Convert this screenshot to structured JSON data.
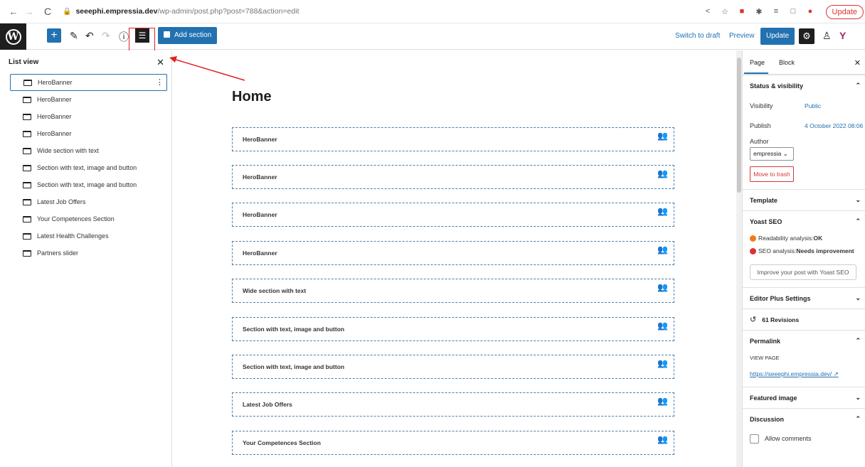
{
  "browser": {
    "back": "←",
    "forward": "→",
    "reload": "C",
    "url_host": "seeephi.empressia.dev",
    "url_path": "/wp-admin/post.php?post=788&action=edit",
    "update_label": "Update"
  },
  "toolbar": {
    "add_section_label": "Add section",
    "switch_to_draft_label": "Switch to draft",
    "preview_label": "Preview",
    "update_label": "Update"
  },
  "list_view": {
    "title": "List view",
    "items": [
      "HeroBanner",
      "HeroBanner",
      "HeroBanner",
      "HeroBanner",
      "Wide section with text",
      "Section with text, image and button",
      "Section with text, image and button",
      "Latest Job Offers",
      "Your Competences Section",
      "Latest Health Challenges",
      "Partners slider"
    ]
  },
  "canvas": {
    "title": "Home",
    "sections": [
      "HeroBanner",
      "HeroBanner",
      "HeroBanner",
      "HeroBanner",
      "Wide section with text",
      "Section with text, image and button",
      "Section with text, image and button",
      "Latest Job Offers",
      "Your Competences Section"
    ]
  },
  "sidebar": {
    "tab_page": "Page",
    "tab_block": "Block",
    "status_visibility": "Status & visibility",
    "visibility_label": "Visibility",
    "visibility_value": "Public",
    "publish_label": "Publish",
    "publish_value": "4 October 2022 08:06",
    "author_label": "Author",
    "author_value": "empressia",
    "move_to_trash": "Move to trash",
    "template": "Template",
    "yoast_seo": "Yoast SEO",
    "readability_prefix": "Readability analysis: ",
    "readability_value": "OK",
    "seo_prefix": "SEO analysis: ",
    "seo_value": "Needs improvement",
    "improve_button": "Improve your post with Yoast SEO",
    "editor_plus": "Editor Plus Settings",
    "revisions": "61 Revisions",
    "permalink": "Permalink",
    "view_page": "VIEW PAGE",
    "permalink_url": "https://seeephi.empressia.dev/",
    "featured_image": "Featured image",
    "discussion": "Discussion",
    "allow_comments": "Allow comments"
  },
  "colors": {
    "accent": "#2271b1",
    "danger": "#d63638",
    "annotation": "#e02020",
    "readability_dot": "#ee7c1b",
    "seo_dot": "#dc3232"
  }
}
